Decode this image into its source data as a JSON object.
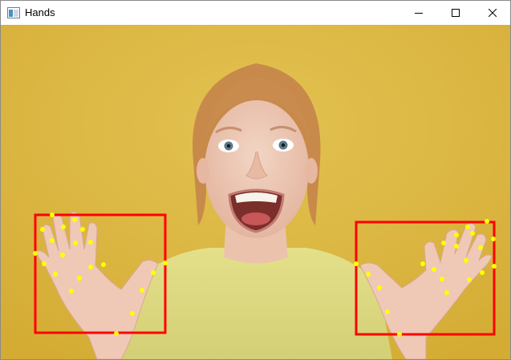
{
  "window": {
    "title": "Hands",
    "icon": "app-window-icon",
    "controls": [
      "minimize-icon",
      "maximize-icon",
      "close-icon"
    ]
  },
  "image": {
    "background_color": "#d9b43c",
    "annotation": {
      "box_color": "#ff0000",
      "keypoint_color": "#ffff00",
      "detected_hands": 2,
      "keypoints_per_hand": 21
    }
  }
}
